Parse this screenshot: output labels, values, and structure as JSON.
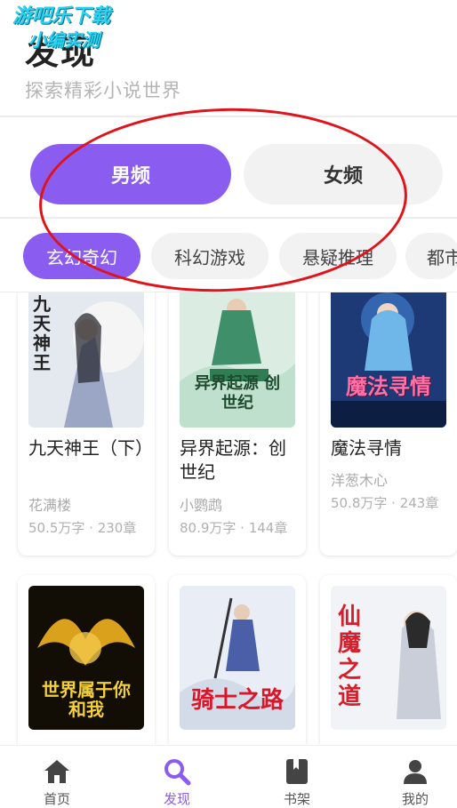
{
  "header": {
    "title": "发现",
    "subtitle": "探索精彩小说世界",
    "watermark_line1": "游吧乐下载",
    "watermark_line2": "小编实测"
  },
  "gender_tabs": [
    {
      "label": "男频",
      "active": true
    },
    {
      "label": "女频",
      "active": false
    }
  ],
  "categories": [
    {
      "label": "玄幻奇幻",
      "active": true
    },
    {
      "label": "科幻游戏",
      "active": false
    },
    {
      "label": "悬疑推理",
      "active": false
    },
    {
      "label": "都市",
      "active": false
    }
  ],
  "books": [
    {
      "title": "九天神王（下）",
      "author": "花满楼",
      "meta": "50.5万字 · 230章",
      "cover_text": "九天神王",
      "cover_color": "#dfe4ec"
    },
    {
      "title": "异界起源：创世纪",
      "author": "小鹦鹉",
      "meta": "80.9万字 · 144章",
      "cover_text": "异界起源 创世纪",
      "cover_color": "#cfe6d8"
    },
    {
      "title": "魔法寻情",
      "author": "洋葱木心",
      "meta": "50.8万字 · 243章",
      "cover_text": "魔法寻情",
      "cover_color": "#1f3a73"
    },
    {
      "title": "",
      "author": "",
      "meta": "",
      "cover_text": "世界属于你和我",
      "cover_color": "#1a1408"
    },
    {
      "title": "",
      "author": "",
      "meta": "",
      "cover_text": "骑士之路",
      "cover_color": "#e7ecf4"
    },
    {
      "title": "",
      "author": "",
      "meta": "",
      "cover_text": "仙魔之道",
      "cover_color": "#eef0f3"
    }
  ],
  "bottom_nav": [
    {
      "label": "首页",
      "icon": "home-icon",
      "active": false
    },
    {
      "label": "发现",
      "icon": "search-icon",
      "active": true
    },
    {
      "label": "书架",
      "icon": "book-icon",
      "active": false
    },
    {
      "label": "我的",
      "icon": "user-icon",
      "active": false
    }
  ],
  "colors": {
    "accent": "#8a5cf0",
    "marker": "#e0121a",
    "inactive_bg": "#f2f2f2"
  }
}
